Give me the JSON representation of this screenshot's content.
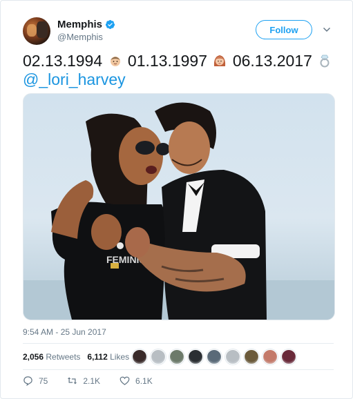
{
  "author": {
    "name": "Memphis",
    "handle": "@Memphis"
  },
  "follow_label": "Follow",
  "tweet": {
    "text_parts": [
      "02.13.1994",
      "01.13.1997",
      "06.13.2017"
    ],
    "emojis": [
      "man-emoji",
      "woman-emoji",
      "ring-emoji"
    ],
    "mention": "@_lori_harvey"
  },
  "timestamp": "9:54 AM - 25 Jun 2017",
  "stats": {
    "retweets_count": "2,056",
    "retweets_label": "Retweets",
    "likes_count": "6,112",
    "likes_label": "Likes"
  },
  "liker_faces": [
    "#3a2b2a",
    "#b8bec3",
    "#6c7a6a",
    "#2b2f33",
    "#5a6a78",
    "#b8bec3",
    "#6b5a3a",
    "#c47a6a",
    "#6a2a3a"
  ],
  "actions": {
    "replies": "75",
    "retweets": "2.1K",
    "likes": "6.1K"
  },
  "colors": {
    "accent": "#1da1f2",
    "mention": "#1b95e0",
    "muted": "#657786"
  }
}
